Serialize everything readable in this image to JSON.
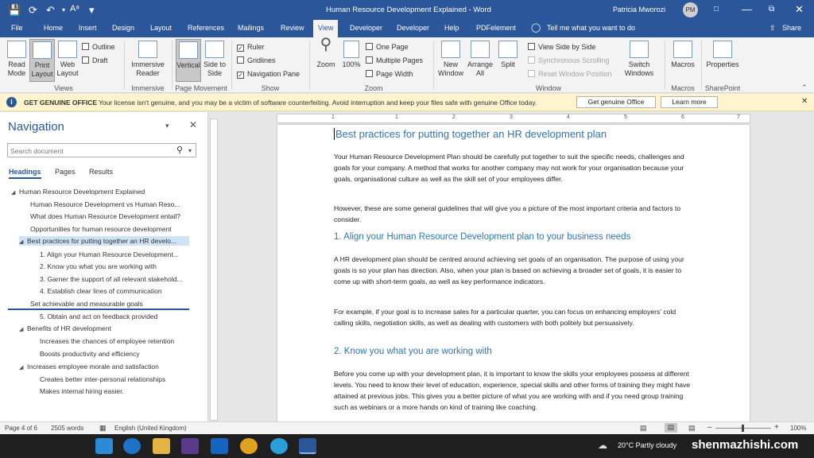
{
  "window": {
    "title": "Human Resource Development Explained  -  Word",
    "user_name": "Patricia Mworozi",
    "user_initials": "PM",
    "tell_me": "Tell me what you want to do",
    "share": "Share"
  },
  "tabs": [
    "File",
    "Home",
    "Insert",
    "Design",
    "Layout",
    "References",
    "Mailings",
    "Review",
    "View",
    "Developer",
    "Developer",
    "Help",
    "PDFelement"
  ],
  "active_tab": "View",
  "ribbon": {
    "views": {
      "read_mode": "Read Mode",
      "print_layout": "Print Layout",
      "web_layout": "Web Layout",
      "outline": "Outline",
      "draft": "Draft",
      "label": "Views"
    },
    "immersive": {
      "reader": "Immersive Reader",
      "label": "Immersive"
    },
    "page_movement": {
      "vertical": "Vertical",
      "side_to_side": "Side to Side",
      "label": "Page Movement"
    },
    "show": {
      "ruler": "Ruler",
      "gridlines": "Gridlines",
      "navigation_pane": "Navigation Pane",
      "label": "Show"
    },
    "zoom": {
      "zoom": "Zoom",
      "hundred": "100%",
      "one_page": "One Page",
      "multiple_pages": "Multiple Pages",
      "page_width": "Page Width",
      "label": "Zoom"
    },
    "window": {
      "new_window": "New Window",
      "arrange_all": "Arrange All",
      "split": "Split",
      "view_side_by_side": "View Side by Side",
      "synchronous_scrolling": "Synchronous Scrolling",
      "reset_window_position": "Reset Window Position",
      "switch_windows": "Switch Windows",
      "label": "Window"
    },
    "macros": {
      "macros": "Macros",
      "label": "Macros"
    },
    "sharepoint": {
      "properties": "Properties",
      "label": "SharePoint"
    }
  },
  "message_bar": {
    "title": "GET GENUINE OFFICE",
    "text": "Your license isn't genuine, and you may be a victim of software counterfeiting. Avoid interruption and keep your files safe with genuine Office today.",
    "button1": "Get genuine Office",
    "button2": "Learn more"
  },
  "navigation": {
    "title": "Navigation",
    "search_placeholder": "Search document",
    "tabs": [
      "Headings",
      "Pages",
      "Results"
    ],
    "items": [
      {
        "text": "Human Resource Development Explained",
        "level": 1,
        "expand": true
      },
      {
        "text": "Human Resource Development vs Human Reso...",
        "level": 2
      },
      {
        "text": "What does Human Resource Development entail?",
        "level": 2
      },
      {
        "text": "Opportunities for human resource development",
        "level": 2
      },
      {
        "text": "Best practices for putting together an HR develo...",
        "level": 2,
        "expand": true,
        "selected": true
      },
      {
        "text": "1. Align your Human Resource Development...",
        "level": 3
      },
      {
        "text": "2. Know you what you are working with",
        "level": 3
      },
      {
        "text": "3. Garner the support of all relevant stakehold...",
        "level": 3
      },
      {
        "text": "4. Establish clear lines of communication",
        "level": 3
      },
      {
        "text": "Set achievable and measurable goals",
        "level": 2
      },
      {
        "text": "5. Obtain and act on feedback provided",
        "level": 3
      },
      {
        "text": "Benefits of HR development",
        "level": 2,
        "expand": true
      },
      {
        "text": "Increases the chances of employee retention",
        "level": 3
      },
      {
        "text": "Boosts productivity and efficiency",
        "level": 3
      },
      {
        "text": "Increases employee morale and satisfaction",
        "level": 2,
        "expand": true
      },
      {
        "text": "Creates better inter-personal relationships",
        "level": 3
      },
      {
        "text": "Makes internal hiring easier.",
        "level": 3
      }
    ]
  },
  "document": {
    "heading": "Best practices for putting together an HR development plan",
    "p1": "Your Human Resource Development Plan should be carefully put together to suit the specific needs, challenges and goals for your company. A method that works for another company may not work for your organisation because your goals, organisational culture as well as the skill set of your employees differ.",
    "p2": "However, these are some general guidelines that will give you a picture of the most important criteria and factors to consider.",
    "h1": "1.  Align your Human Resource Development plan to your business needs",
    "p3": "A HR development plan should be centred around achieving set goals of an organisation. The purpose of using your goals is so your plan has direction. Also, when your plan is based on achieving a broader set of goals, it is easier to come up with short-term goals, as well as key performance indicators.",
    "p4": "For example, if your goal is to increase sales for a particular quarter, you can focus on enhancing employers' cold calling skills, negotiation skills, as well as dealing with customers with both politely but persuasively.",
    "h2": "2.  Know you what you are working with",
    "p5": "Before you come up with your development plan, it is important to know the skills your employees possess at different levels. You need to know their level of education, experience, special skills and other forms of training they might have attained at previous jobs. This gives you a better picture of what you are working with and if you need group training such as webinars or a more hands on kind of training like coaching."
  },
  "ruler_numbers": [
    "1",
    "1",
    "2",
    "3",
    "4",
    "5",
    "6",
    "7"
  ],
  "status": {
    "page": "Page 4 of 6",
    "words": "2505 words",
    "language": "English (United Kingdom)",
    "zoom": "100%"
  },
  "taskbar": {
    "weather": "20°C  Partly cloudy",
    "watermark": "shenmazhishi.com"
  },
  "colors": {
    "word_blue": "#2b579a",
    "heading_blue": "#2e74b5",
    "warning_bar": "#fff4ce"
  }
}
